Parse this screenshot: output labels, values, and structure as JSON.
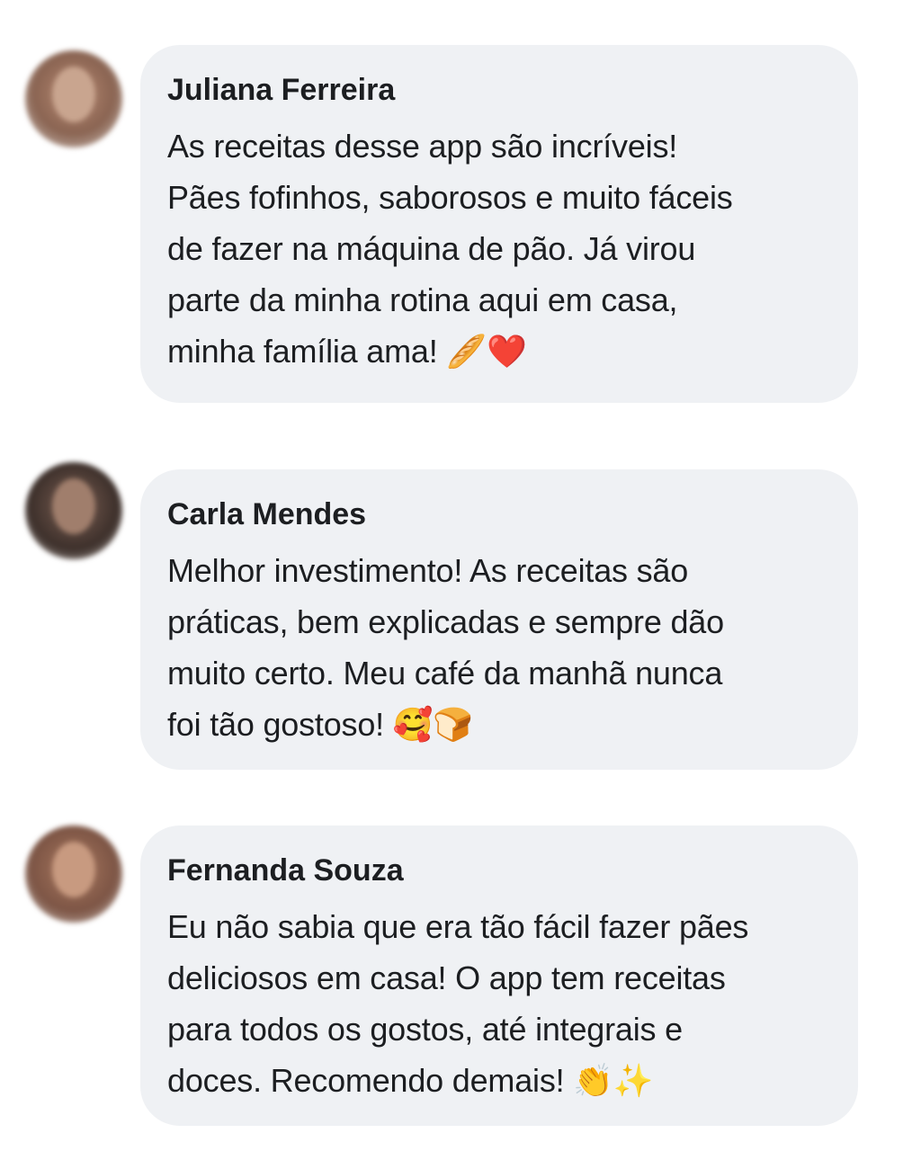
{
  "comments": [
    {
      "author": "Juliana Ferreira",
      "lines": [
        "As receitas desse app são incríveis!",
        "Pães fofinhos, saborosos e muito fáceis",
        "de fazer na máquina de pão. Já virou",
        "parte da minha rotina aqui em casa,",
        "minha família ama! 🥖❤️"
      ],
      "avatar_colors": [
        "#8a6452",
        "#c9a58f"
      ]
    },
    {
      "author": "Carla Mendes",
      "lines": [
        "Melhor investimento! As receitas são",
        "práticas, bem explicadas e sempre dão",
        "muito certo. Meu café da manhã nunca",
        "foi tão gostoso! 🥰🍞"
      ],
      "avatar_colors": [
        "#4a3a33",
        "#a07e6c"
      ]
    },
    {
      "author": "Fernanda Souza",
      "lines": [
        "Eu não sabia que era tão fácil fazer pães",
        "deliciosos em casa! O app tem receitas",
        "para todos os gostos, até integrais e",
        "doces. Recomendo demais! 👏✨"
      ],
      "avatar_colors": [
        "#7d5545",
        "#c89a80"
      ]
    }
  ]
}
